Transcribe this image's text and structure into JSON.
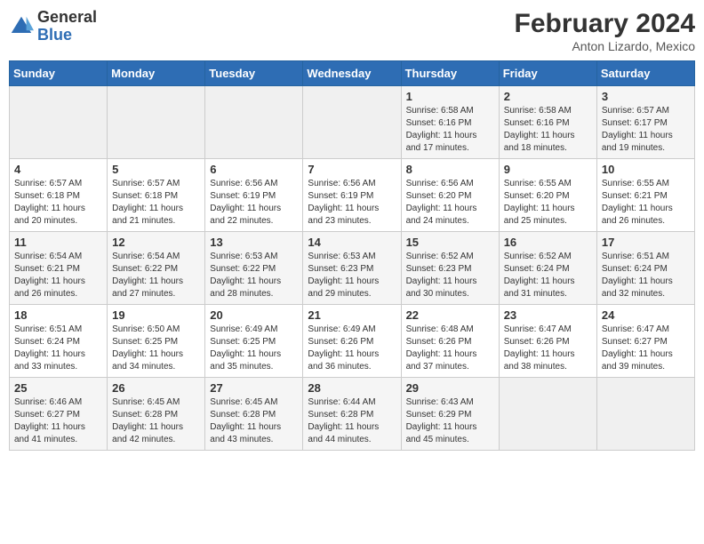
{
  "header": {
    "logo_general": "General",
    "logo_blue": "Blue",
    "title": "February 2024",
    "location": "Anton Lizardo, Mexico"
  },
  "weekdays": [
    "Sunday",
    "Monday",
    "Tuesday",
    "Wednesday",
    "Thursday",
    "Friday",
    "Saturday"
  ],
  "weeks": [
    [
      {
        "day": "",
        "info": ""
      },
      {
        "day": "",
        "info": ""
      },
      {
        "day": "",
        "info": ""
      },
      {
        "day": "",
        "info": ""
      },
      {
        "day": "1",
        "info": "Sunrise: 6:58 AM\nSunset: 6:16 PM\nDaylight: 11 hours and 17 minutes."
      },
      {
        "day": "2",
        "info": "Sunrise: 6:58 AM\nSunset: 6:16 PM\nDaylight: 11 hours and 18 minutes."
      },
      {
        "day": "3",
        "info": "Sunrise: 6:57 AM\nSunset: 6:17 PM\nDaylight: 11 hours and 19 minutes."
      }
    ],
    [
      {
        "day": "4",
        "info": "Sunrise: 6:57 AM\nSunset: 6:18 PM\nDaylight: 11 hours and 20 minutes."
      },
      {
        "day": "5",
        "info": "Sunrise: 6:57 AM\nSunset: 6:18 PM\nDaylight: 11 hours and 21 minutes."
      },
      {
        "day": "6",
        "info": "Sunrise: 6:56 AM\nSunset: 6:19 PM\nDaylight: 11 hours and 22 minutes."
      },
      {
        "day": "7",
        "info": "Sunrise: 6:56 AM\nSunset: 6:19 PM\nDaylight: 11 hours and 23 minutes."
      },
      {
        "day": "8",
        "info": "Sunrise: 6:56 AM\nSunset: 6:20 PM\nDaylight: 11 hours and 24 minutes."
      },
      {
        "day": "9",
        "info": "Sunrise: 6:55 AM\nSunset: 6:20 PM\nDaylight: 11 hours and 25 minutes."
      },
      {
        "day": "10",
        "info": "Sunrise: 6:55 AM\nSunset: 6:21 PM\nDaylight: 11 hours and 26 minutes."
      }
    ],
    [
      {
        "day": "11",
        "info": "Sunrise: 6:54 AM\nSunset: 6:21 PM\nDaylight: 11 hours and 26 minutes."
      },
      {
        "day": "12",
        "info": "Sunrise: 6:54 AM\nSunset: 6:22 PM\nDaylight: 11 hours and 27 minutes."
      },
      {
        "day": "13",
        "info": "Sunrise: 6:53 AM\nSunset: 6:22 PM\nDaylight: 11 hours and 28 minutes."
      },
      {
        "day": "14",
        "info": "Sunrise: 6:53 AM\nSunset: 6:23 PM\nDaylight: 11 hours and 29 minutes."
      },
      {
        "day": "15",
        "info": "Sunrise: 6:52 AM\nSunset: 6:23 PM\nDaylight: 11 hours and 30 minutes."
      },
      {
        "day": "16",
        "info": "Sunrise: 6:52 AM\nSunset: 6:24 PM\nDaylight: 11 hours and 31 minutes."
      },
      {
        "day": "17",
        "info": "Sunrise: 6:51 AM\nSunset: 6:24 PM\nDaylight: 11 hours and 32 minutes."
      }
    ],
    [
      {
        "day": "18",
        "info": "Sunrise: 6:51 AM\nSunset: 6:24 PM\nDaylight: 11 hours and 33 minutes."
      },
      {
        "day": "19",
        "info": "Sunrise: 6:50 AM\nSunset: 6:25 PM\nDaylight: 11 hours and 34 minutes."
      },
      {
        "day": "20",
        "info": "Sunrise: 6:49 AM\nSunset: 6:25 PM\nDaylight: 11 hours and 35 minutes."
      },
      {
        "day": "21",
        "info": "Sunrise: 6:49 AM\nSunset: 6:26 PM\nDaylight: 11 hours and 36 minutes."
      },
      {
        "day": "22",
        "info": "Sunrise: 6:48 AM\nSunset: 6:26 PM\nDaylight: 11 hours and 37 minutes."
      },
      {
        "day": "23",
        "info": "Sunrise: 6:47 AM\nSunset: 6:26 PM\nDaylight: 11 hours and 38 minutes."
      },
      {
        "day": "24",
        "info": "Sunrise: 6:47 AM\nSunset: 6:27 PM\nDaylight: 11 hours and 39 minutes."
      }
    ],
    [
      {
        "day": "25",
        "info": "Sunrise: 6:46 AM\nSunset: 6:27 PM\nDaylight: 11 hours and 41 minutes."
      },
      {
        "day": "26",
        "info": "Sunrise: 6:45 AM\nSunset: 6:28 PM\nDaylight: 11 hours and 42 minutes."
      },
      {
        "day": "27",
        "info": "Sunrise: 6:45 AM\nSunset: 6:28 PM\nDaylight: 11 hours and 43 minutes."
      },
      {
        "day": "28",
        "info": "Sunrise: 6:44 AM\nSunset: 6:28 PM\nDaylight: 11 hours and 44 minutes."
      },
      {
        "day": "29",
        "info": "Sunrise: 6:43 AM\nSunset: 6:29 PM\nDaylight: 11 hours and 45 minutes."
      },
      {
        "day": "",
        "info": ""
      },
      {
        "day": "",
        "info": ""
      }
    ]
  ]
}
